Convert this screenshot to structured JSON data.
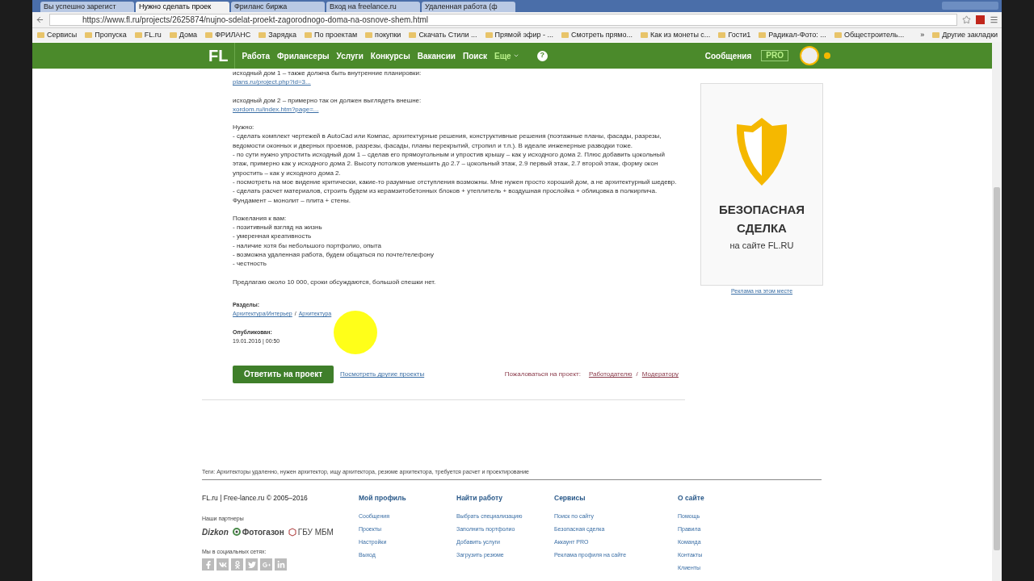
{
  "browser": {
    "tabs": [
      {
        "title": "Вы успешно зарегист",
        "selected": false
      },
      {
        "title": "Нужно сделать проек",
        "selected": true
      },
      {
        "title": "Фриланс биржа",
        "selected": false
      },
      {
        "title": "Вход на freelance.ru",
        "selected": false
      },
      {
        "title": "Удаленная работа (ф",
        "selected": false
      }
    ],
    "url": "https://www.fl.ru/projects/2625874/nujno-sdelat-proekt-zagorodnogo-doma-na-osnove-shem.html",
    "bookmarks": [
      "Сервисы",
      "Пропуска",
      "FL.ru",
      "Дома",
      "ФРИЛАНС",
      "Зарядка",
      "По проектам",
      "покупки",
      "Скачать Стили ...",
      "Прямой эфир - ...",
      "Смотреть прямо...",
      "Как из монеты с...",
      "Гости1",
      "Радикал-Фото: ...",
      "Общестроитель..."
    ],
    "more": "»",
    "other_bookmarks": "Другие закладки"
  },
  "nav": {
    "logo": "FL",
    "items": [
      "Работа",
      "Фрилансеры",
      "Услуги",
      "Конкурсы",
      "Вакансии",
      "Поиск"
    ],
    "more": "Еще",
    "help": "?",
    "messages": "Сообщения",
    "pro": "PRO"
  },
  "project": {
    "blocks": [
      [
        {
          "kind": "text",
          "text": "исходный дом 1 – также должна быть внутренние планировки:"
        },
        {
          "kind": "link",
          "text": "plans.ru/project.php?id=3..."
        }
      ],
      [
        {
          "kind": "text",
          "text": "исходный дом 2 – примерно так он должен выглядеть внешне:"
        },
        {
          "kind": "link",
          "text": "xordom.ru/index.htm?page=..."
        }
      ],
      [
        {
          "kind": "text",
          "text": "Нужно:"
        },
        {
          "kind": "text",
          "text": "- сделать комплект чертежей в AutoCad или Компас, архитектурные решения, конструктивные решения (поэтажные планы, фасады, разрезы, ведомости оконных и дверных проемов, разрезы, фасады, планы перекрытий, стропил и т.п.). В идеале инженерные разводки тоже."
        },
        {
          "kind": "text",
          "text": "- по сути нужно упростить исходный дом 1 – сделав его прямоугольным и упростив крышу – как у исходного дома 2. Плюс добавить цокольный этаж, примерно как у исходного дома 2. Высоту потолков уменьшить до 2.7 – цокольный этаж, 2.9 первый этаж, 2.7 второй этаж, форму окон упростить –  как у исходного дома 2."
        },
        {
          "kind": "text",
          "text": "- посмотреть на мое видение критически, какие-то разумные отступления возможны. Мне нужен просто хороший дом, а не архитектурный шедевр."
        },
        {
          "kind": "text",
          "text": "- сделать расчет материалов, строить будем из керамзитобетонных блоков + утеплитель + воздушная прослойка + облицовка в полкирпича. Фундамент – монолит – плита + стены."
        }
      ],
      [
        {
          "kind": "text",
          "text": "Пожелания к вам:"
        },
        {
          "kind": "text",
          "text": "- позитивный взгляд на жизнь"
        },
        {
          "kind": "text",
          "text": "- умеренная креативность"
        },
        {
          "kind": "text",
          "text": "- наличие хотя бы небольшого портфолио, опыта"
        },
        {
          "kind": "text",
          "text": "- возможна удаленная работа, будем общаться по почте/телефону"
        },
        {
          "kind": "text",
          "text": "- честность"
        }
      ],
      [
        {
          "kind": "text",
          "text": "Предлагаю около 10 000, сроки обсуждаются, большой спешки нет."
        }
      ]
    ],
    "sections_label": "Разделы:",
    "sections": [
      "Архитектура/Интерьер",
      "Архитектура"
    ],
    "sections_sep": "/",
    "published_label": "Опубликован:",
    "published": "19.01.2016 | 00:50",
    "respond": "Ответить на проект",
    "other_projects": "Посмотреть другие проекты",
    "complain_label": "Пожаловаться на проект:",
    "complain": [
      "Работодателю",
      "Модератору"
    ],
    "complain_sep": "/"
  },
  "ad": {
    "title": "БЕЗОПАСНАЯ СДЕЛКА",
    "subtitle": "на сайте FL.RU",
    "link": "Реклама на этом месте"
  },
  "footer": {
    "tags": "Теги: Архитекторы удаленно, нужен архитектор, ищу архитектора, резюме архитектора, требуется расчет и проектирование",
    "copyright": "FL.ru | Free-lance.ru © 2005–2016",
    "partners_label": "Наши партнеры",
    "partners": [
      "Dizkon",
      "Фотогазон",
      "ГБУ МБМ"
    ],
    "social_label": "Мы в социальных сетях:",
    "columns": [
      {
        "title": "Мой профиль",
        "links": [
          "Сообщения",
          "Проекты",
          "Настройки",
          "Выход"
        ]
      },
      {
        "title": "Найти работу",
        "links": [
          "Выбрать специализацию",
          "Заполнить портфолио",
          "Добавить услуги",
          "Загрузить резюме"
        ]
      },
      {
        "title": "Сервисы",
        "links": [
          "Поиск по сайту",
          "Безопасная сделка",
          "Аккаунт PRO",
          "Реклама профиля на сайте"
        ]
      },
      {
        "title": "О сайте",
        "links": [
          "Помощь",
          "Правила",
          "Команда",
          "Контакты",
          "Клиенты"
        ]
      }
    ]
  }
}
